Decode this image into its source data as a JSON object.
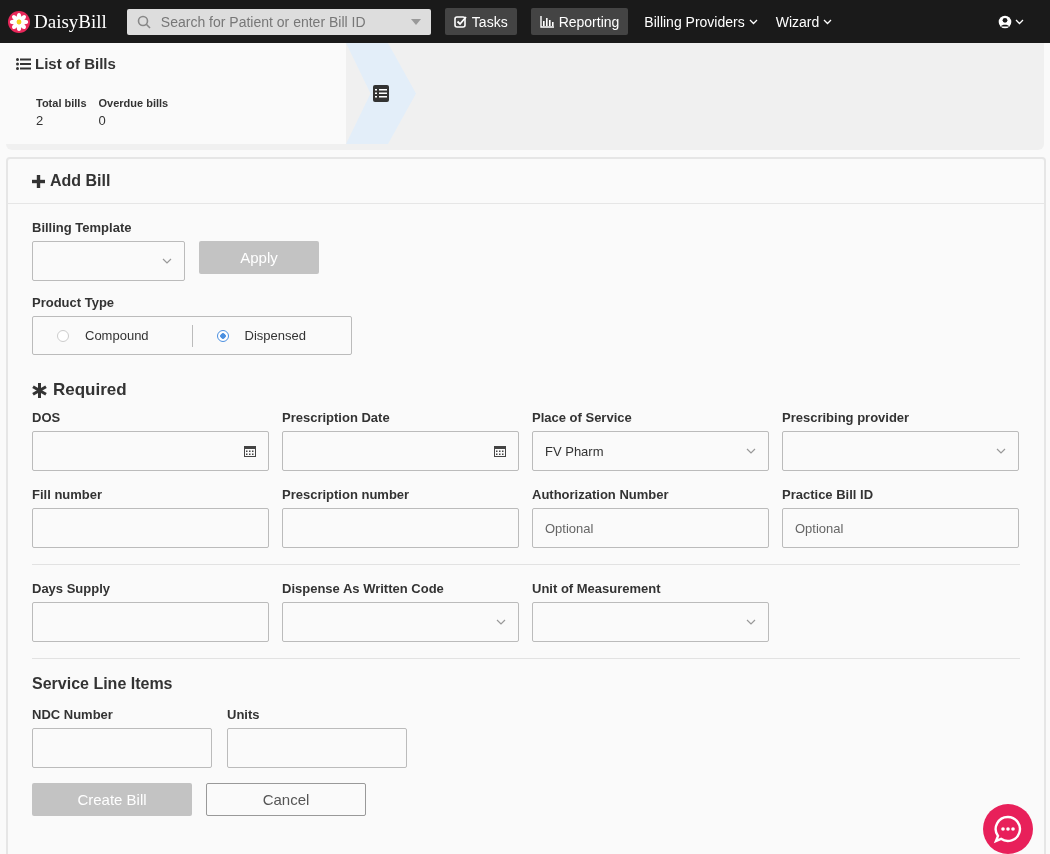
{
  "navbar": {
    "logo": "DaisyBill",
    "search": {
      "placeholder": "Search for Patient or enter Bill ID"
    },
    "items": [
      {
        "label": "Tasks",
        "kind": "button"
      },
      {
        "label": "Reporting",
        "kind": "button"
      },
      {
        "label": "Billing Providers",
        "kind": "dropdown"
      },
      {
        "label": "Wizard",
        "kind": "dropdown"
      }
    ]
  },
  "summary": {
    "title": "List of Bills",
    "stats": [
      {
        "label": "Total bills",
        "value": "2"
      },
      {
        "label": "Overdue bills",
        "value": "0"
      }
    ]
  },
  "form": {
    "title": "Add Bill",
    "template": {
      "label": "Billing Template",
      "apply": {
        "label": "Apply",
        "disabled": true
      }
    },
    "product_type": {
      "label": "Product Type",
      "options": [
        {
          "label": "Compound",
          "selected": false
        },
        {
          "label": "Dispensed",
          "selected": true
        }
      ]
    },
    "required_title": "Required",
    "sections": [
      {
        "rows": [
          [
            {
              "label": "DOS",
              "kind": "date"
            },
            {
              "label": "Prescription Date",
              "kind": "date"
            },
            {
              "label": "Place of Service",
              "kind": "select",
              "value": "FV Pharm"
            },
            {
              "label": "Prescribing provider",
              "kind": "select"
            }
          ],
          [
            {
              "label": "Fill number",
              "kind": "text"
            },
            {
              "label": "Prescription number",
              "kind": "text"
            },
            {
              "label": "Authorization Number",
              "kind": "text",
              "placeholder": "Optional"
            },
            {
              "label": "Practice Bill ID",
              "kind": "text",
              "placeholder": "Optional"
            }
          ]
        ]
      },
      {
        "rows": [
          [
            {
              "label": "Days Supply",
              "kind": "text"
            },
            {
              "label": "Dispense As Written Code",
              "kind": "select"
            },
            {
              "label": "Unit of Measurement",
              "kind": "select"
            }
          ]
        ]
      }
    ],
    "service_line": {
      "title": "Service Line Items",
      "fields": [
        {
          "label": "NDC Number",
          "kind": "text"
        },
        {
          "label": "Units",
          "kind": "text"
        }
      ]
    },
    "buttons": [
      {
        "label": "Create Bill",
        "kind": "primary",
        "disabled": true
      },
      {
        "label": "Cancel",
        "kind": "secondary",
        "disabled": false
      }
    ]
  }
}
